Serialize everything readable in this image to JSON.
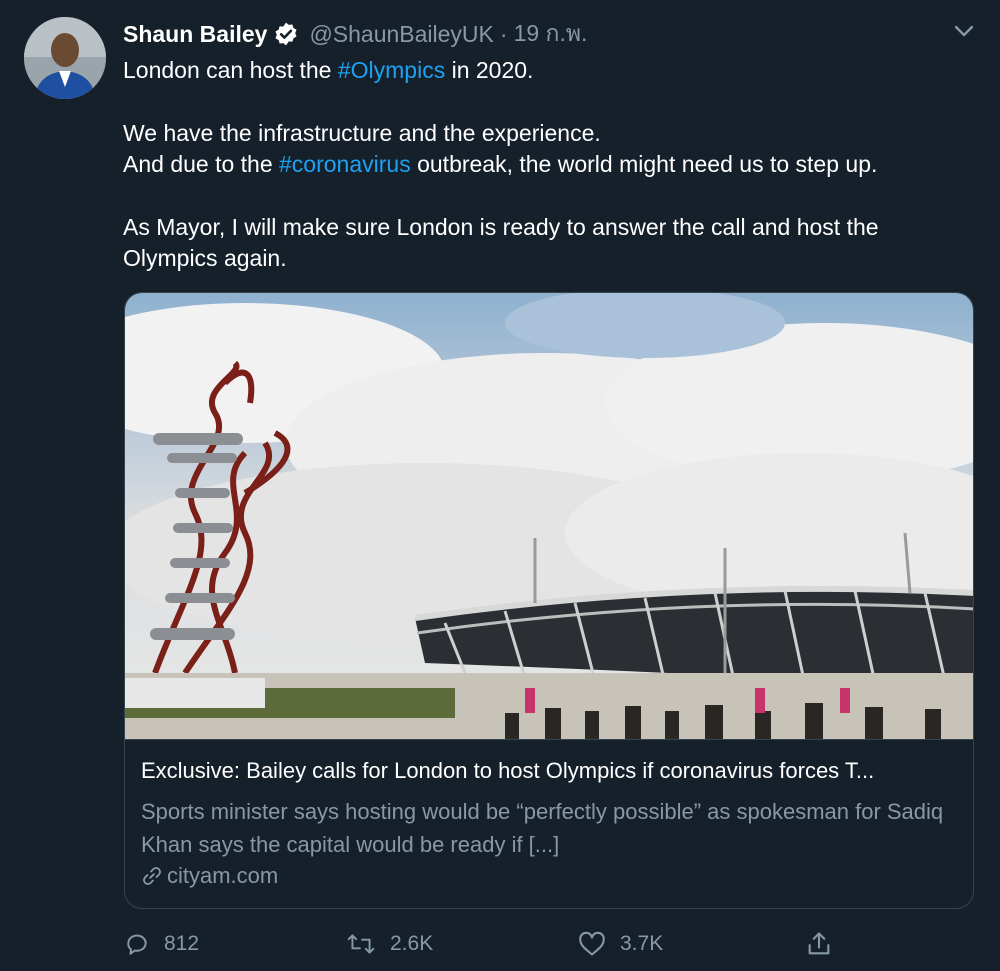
{
  "author": {
    "name": "Shaun Bailey",
    "handle": "@ShaunBaileyUK",
    "separator": "·",
    "date": "19 ก.พ."
  },
  "tweet": {
    "line1_pre": "London can host the ",
    "line1_tag": "#Olympics",
    "line1_post": " in 2020.",
    "line2": "We have the infrastructure and the experience.",
    "line3_pre": "And due to the ",
    "line3_tag": "#coronavirus",
    "line3_post": " outbreak, the world might need us to step up.",
    "line4": "As Mayor, I will make sure London is ready to answer the call and host the Olympics again."
  },
  "card": {
    "title": "Exclusive: Bailey calls for London to host Olympics if coronavirus forces T...",
    "description": "Sports minister says hosting would be “perfectly possible” as spokesman for Sadiq Khan says the capital would be ready if [...]",
    "domain": "cityam.com",
    "link_icon": "link-icon"
  },
  "actions": {
    "reply_count": "812",
    "retweet_count": "2.6K",
    "like_count": "3.7K"
  },
  "colors": {
    "background": "#15202b",
    "accent": "#1da1f2",
    "secondary_text": "#8899a6",
    "border": "#38444d"
  }
}
